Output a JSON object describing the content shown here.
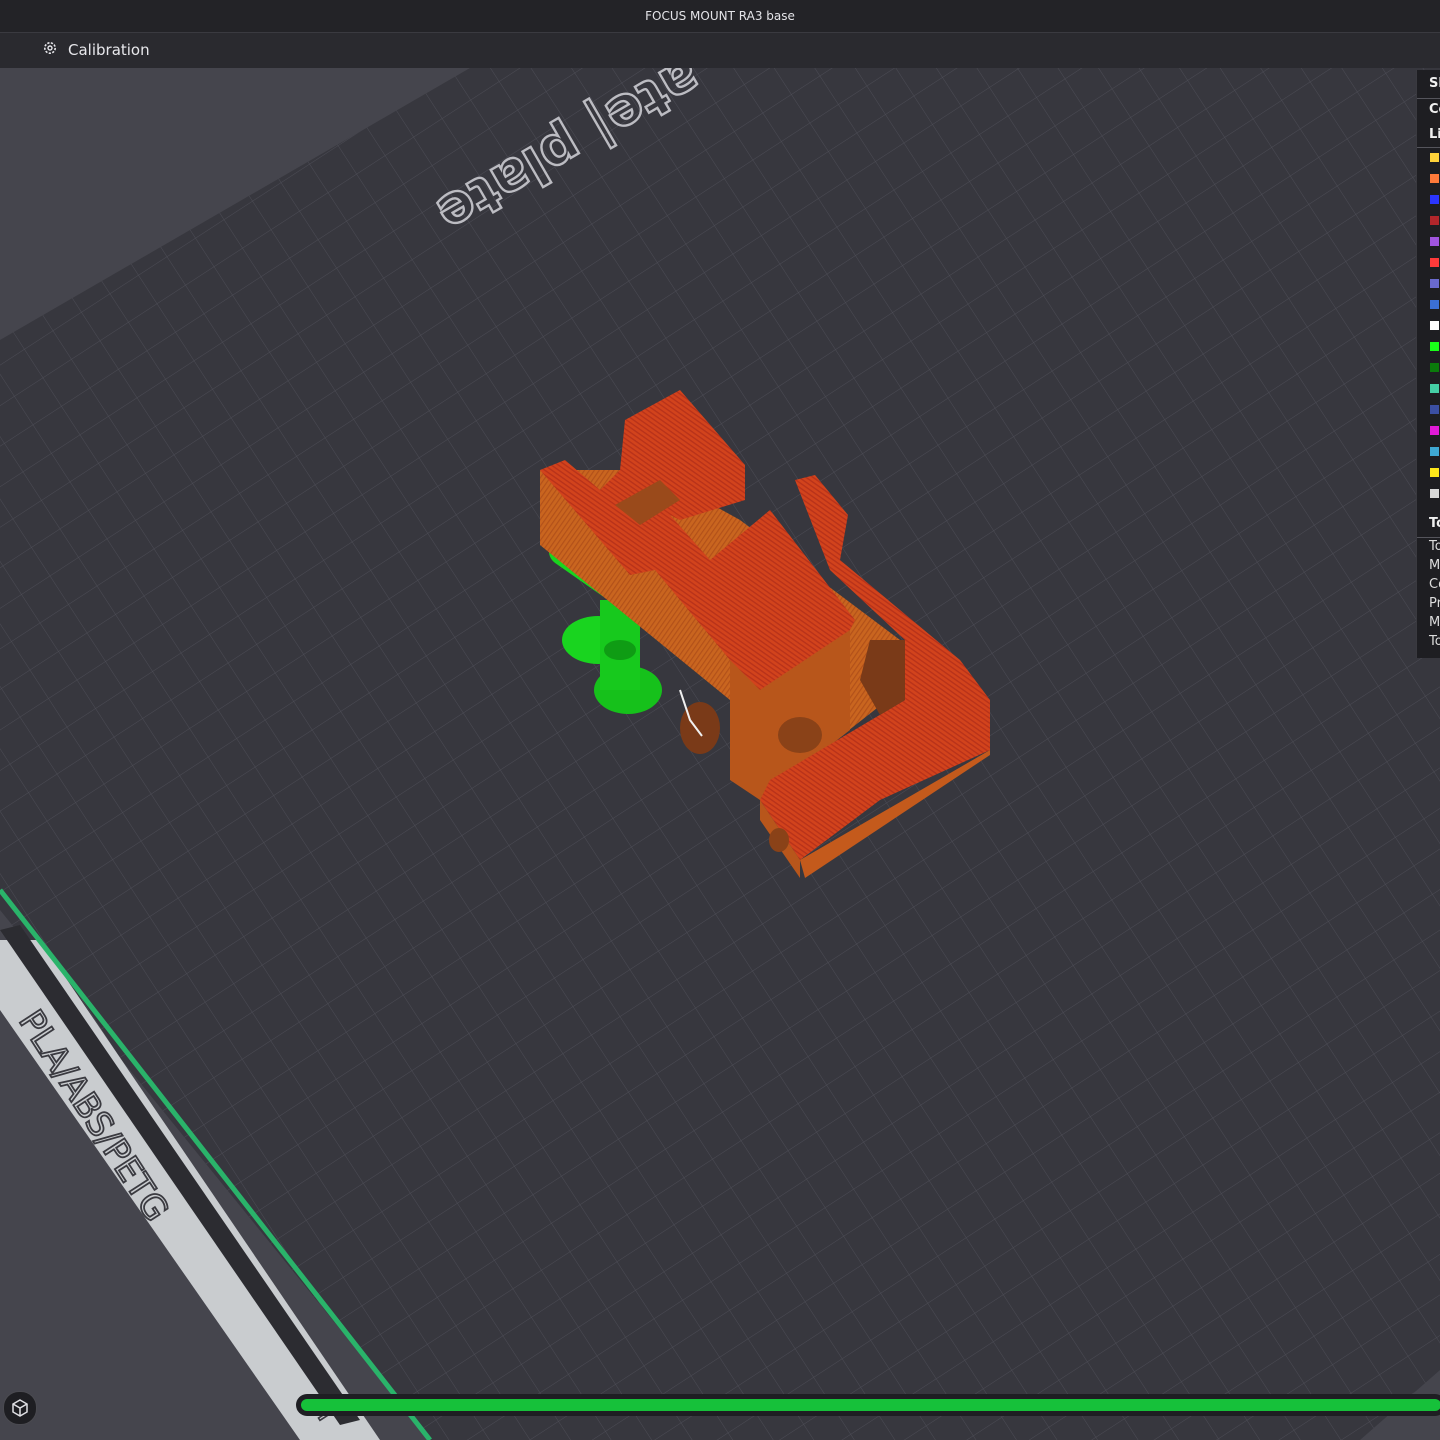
{
  "window": {
    "title": "FOCUS MOUNT RA3 base"
  },
  "toolbar": {
    "calibration_label": "Calibration",
    "calibration_icon": "gear-icon"
  },
  "scene": {
    "plate_label": "ate| plate",
    "plate_side_label": "PLA/ABS/PETG",
    "plate_corner_label": "H",
    "colors": {
      "model": "#d2501f",
      "support": "#19d41f",
      "plate": "#3a3a42",
      "grid": "#4c4c55",
      "accent": "#2ab36a"
    }
  },
  "legend": {
    "header_cut": "Sl",
    "row2_cut": "Co",
    "row3_cut": "Li",
    "swatches": [
      "#ffd23a",
      "#ff7a3a",
      "#2b35ff",
      "#b1262b",
      "#a155e0",
      "#ff3a3a",
      "#6a6acf",
      "#3b6fd6",
      "#ffffff",
      "#19ff19",
      "#0b7a0b",
      "#45cfa6",
      "#3b4fa3",
      "#e11ad7",
      "#3fa9d4",
      "#ffe81a",
      "#d8d8d8"
    ],
    "totals_header_cut": "To",
    "totals_rows_cut": [
      "To",
      "M",
      "Co",
      "Pr",
      "M",
      "To"
    ]
  },
  "layer_slider": {
    "value_fraction": 1.0,
    "color": "#16c13a"
  }
}
